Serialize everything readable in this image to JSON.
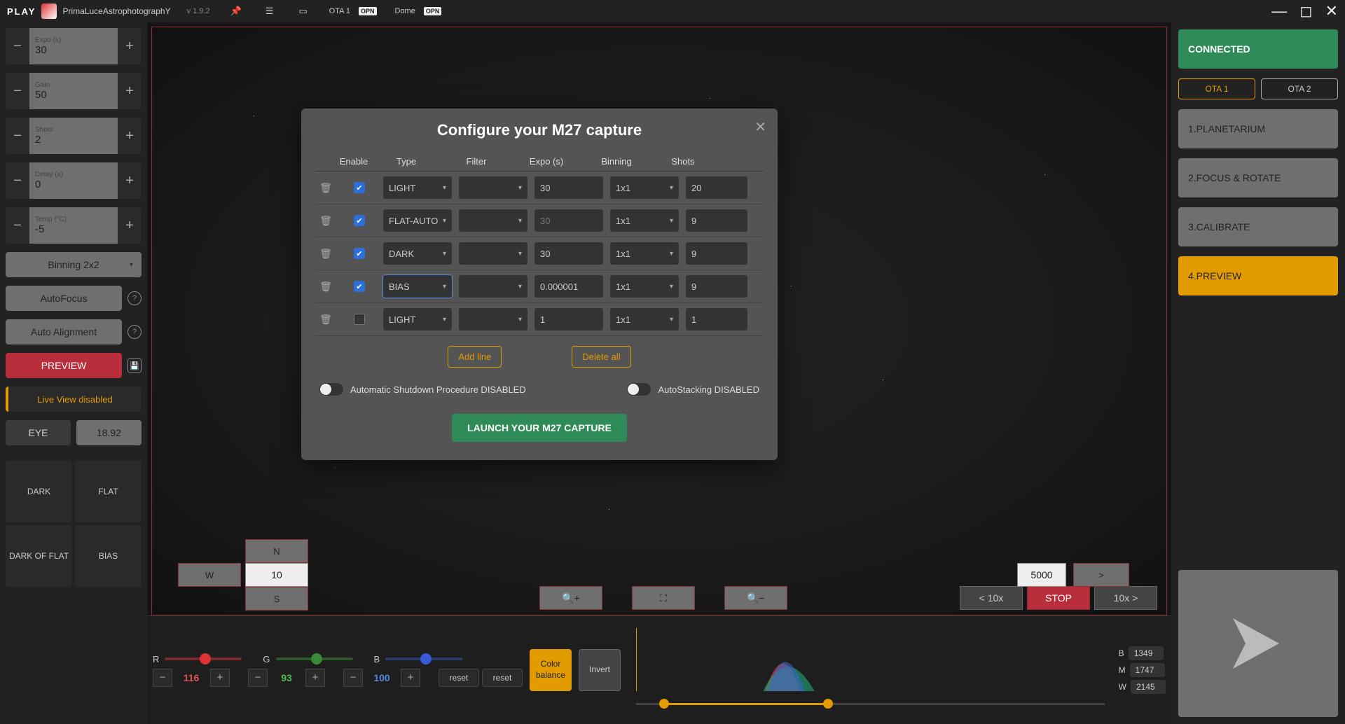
{
  "topbar": {
    "play": "PLAY",
    "brand": "PrimaLuceAstrophotographY",
    "version": "v 1.9.2",
    "ota1_label": "OTA 1",
    "ota1_badge": "OPN",
    "dome_label": "Dome",
    "dome_badge": "OPN"
  },
  "left": {
    "expo_label": "Expo (s)",
    "expo_value": "30",
    "gain_label": "Gain",
    "gain_value": "50",
    "shots_label": "Shots",
    "shots_value": "2",
    "delay_label": "Delay (s)",
    "delay_value": "0",
    "temp_label": "Temp (°C)",
    "temp_value": "-5",
    "binning": "Binning 2x2",
    "autofocus": "AutoFocus",
    "autoalign": "Auto Alignment",
    "preview": "PREVIEW",
    "liveview": "Live View disabled",
    "eye_label": "EYE",
    "eye_value": "18.92",
    "calib": {
      "dark": "DARK",
      "flat": "FLAT",
      "dof": "DARK OF FLAT",
      "bias": "BIAS"
    }
  },
  "nav": {
    "n": "N",
    "s": "S",
    "w": "W",
    "val": "10",
    "speed": "5000",
    "lt": "< 10x",
    "stop": "STOP",
    "gt": "10x >",
    "e": ">"
  },
  "bottom": {
    "r_label": "R",
    "g_label": "G",
    "b_label": "B",
    "r_val": "116",
    "g_val": "93",
    "b_val": "100",
    "reset": "reset",
    "colorbal": "Color balance",
    "invert": "Invert",
    "b": "B",
    "m": "M",
    "w": "W",
    "b_v": "1349",
    "m_v": "1747",
    "w_v": "2145"
  },
  "right": {
    "connected": "CONNECTED",
    "ota1": "OTA 1",
    "ota2": "OTA 2",
    "s1": "1.PLANETARIUM",
    "s2": "2.FOCUS & ROTATE",
    "s3": "3.CALIBRATE",
    "s4": "4.PREVIEW"
  },
  "modal": {
    "title": "Configure your M27 capture",
    "h_enable": "Enable",
    "h_type": "Type",
    "h_filter": "Filter",
    "h_expo": "Expo (s)",
    "h_bin": "Binning",
    "h_shots": "Shots",
    "rows": [
      {
        "en": true,
        "type": "LIGHT",
        "filter": "",
        "expo": "30",
        "bin": "1x1",
        "shots": "20",
        "dis": false,
        "hl": false
      },
      {
        "en": true,
        "type": "FLAT-AUTO",
        "filter": "",
        "expo": "30",
        "bin": "1x1",
        "shots": "9",
        "dis": true,
        "hl": false
      },
      {
        "en": true,
        "type": "DARK",
        "filter": "",
        "expo": "30",
        "bin": "1x1",
        "shots": "9",
        "dis": false,
        "hl": false
      },
      {
        "en": true,
        "type": "BIAS",
        "filter": "",
        "expo": "0.000001",
        "bin": "1x1",
        "shots": "9",
        "dis": false,
        "hl": true
      },
      {
        "en": false,
        "type": "LIGHT",
        "filter": "",
        "expo": "1",
        "bin": "1x1",
        "shots": "1",
        "dis": false,
        "hl": false
      }
    ],
    "addline": "Add line",
    "deleteall": "Delete all",
    "auto_shutdown": "Automatic Shutdown Procedure DISABLED",
    "autostack": "AutoStacking DISABLED",
    "launch": "LAUNCH YOUR M27 CAPTURE"
  }
}
